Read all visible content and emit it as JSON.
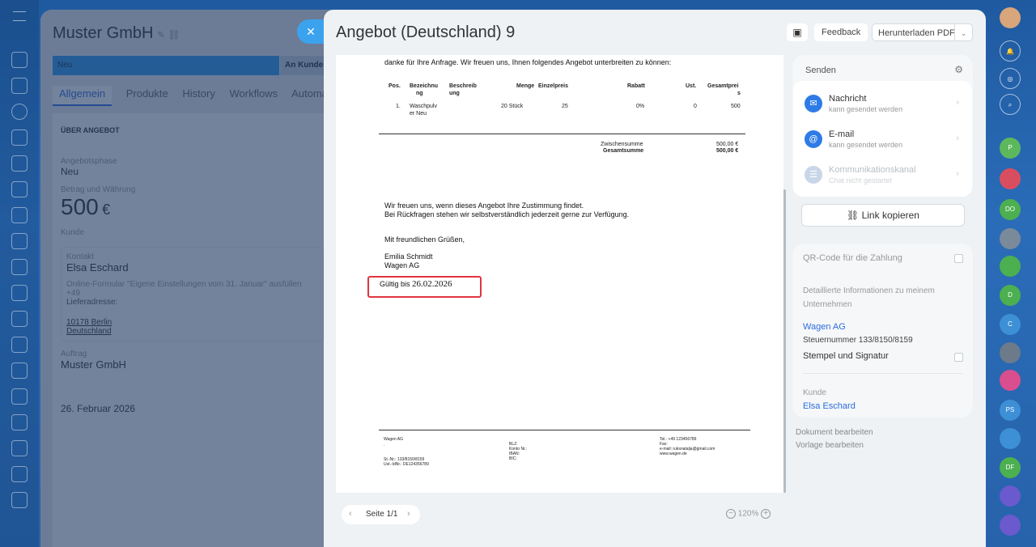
{
  "crm": {
    "title": "Muster GmbH",
    "stage_new": "Neu",
    "stage_next": "An Kunden",
    "tabs": [
      "Allgemein",
      "Produkte",
      "History",
      "Workflows",
      "Automatisie"
    ],
    "section_header": "ÜBER ANGEBOT",
    "phase_label": "Angebotsphase",
    "phase_value": "Neu",
    "amount_label": "Betrag und Währung",
    "amount_value": "500",
    "currency": "€",
    "client_label": "Kunde",
    "contact_label": "Kontakt",
    "contact_name": "Elsa Eschard",
    "form_note": "Online-Formular \"Eigene Einstellungen vom 31. Januar\" ausfüllen",
    "phone_prefix": "+49",
    "delivery_label": "Lieferadresse:",
    "city": "10178 Berlin",
    "country": "Deutschland",
    "company_label": "Auftrag",
    "company_name": "Muster GmbH",
    "date_value": "26. Februar 2026"
  },
  "modal": {
    "title": "Angebot (Deutschland) 9",
    "feedback": "Feedback",
    "download": "Herunterladen PDF"
  },
  "document": {
    "intro": "danke für Ihre Anfrage. Wir freuen uns, Ihnen folgendes Angebot unterbreiten zu können:",
    "columns": [
      "Pos.",
      "Bezeichnung",
      "Beschreibung",
      "Menge",
      "Einzelpreis",
      "Rabatt",
      "Ust.",
      "Gesamtpreis"
    ],
    "col_bez": [
      "Bezeichnu",
      "ng"
    ],
    "col_besch": [
      "Beschreib",
      "ung"
    ],
    "col_ges": [
      "Gesamtprei",
      "s"
    ],
    "row": {
      "pos": "1.",
      "name1": "Waschpulv",
      "name2": "er Neu",
      "menge": "20 Stück",
      "einzelpreis": "25",
      "rabatt": "0%",
      "ust": "0",
      "gesamt": "500"
    },
    "subtotal_label": "Zwischensumme",
    "subtotal_value": "500,00 €",
    "total_label": "Gesamtsumme",
    "total_value": "500,00 €",
    "closing1": "Wir freuen uns, wenn dieses Angebot Ihre Zustimmung findet.",
    "closing2": "Bei Rückfragen stehen wir selbstverständlich jederzeit gerne zur Verfügung.",
    "greeting": "Mit freundlichen Grüßen,",
    "signer": "Emilia Schmidt",
    "company": "Wagen AG",
    "valid_label": "Gültig bis",
    "valid_date": "26.02.2026",
    "footer": {
      "company": "Wagen AG",
      "dot": ".",
      "tax1": "St.-Nr.: 133/8150/8159",
      "tax2": "Ust.-IdNr.: DE124356789",
      "blz": "BLZ:",
      "konto": "Konto Nr.:",
      "iban": "IBAN:",
      "bic": "BIC:",
      "tel": "Tel.: +49 123456789",
      "fax": "Fax:",
      "email": "e-mail: ruksnatalja@gmail.com",
      "web": "www.wagen.de"
    }
  },
  "pager": {
    "label": "Seite 1/1",
    "zoom": "120%"
  },
  "send": {
    "title": "Senden",
    "items": [
      {
        "name": "Nachricht",
        "sub": "kann gesendet werden"
      },
      {
        "name": "E-mail",
        "sub": "kann gesendet werden"
      },
      {
        "name": "Kommunikationskanal",
        "sub": "Chat nicht gestartet"
      }
    ],
    "copy_link": "Link kopieren"
  },
  "info": {
    "qr_label": "QR-Code für die Zahlung",
    "details_label": "Detaillierte Informationen zu meinem Unternehmen",
    "company_link": "Wagen AG",
    "tax_number": "Steuernummer 133/8150/8159",
    "stamp_label": "Stempel und Signatur",
    "client_label": "Kunde",
    "client_link": "Elsa Eschard"
  },
  "edit": {
    "doc": "Dokument bearbeiten",
    "template": "Vorlage bearbeiten"
  },
  "right_bar": [
    "P",
    "DO",
    "D",
    "C",
    "PS",
    "DF"
  ],
  "colors": {
    "accent": "#2d6cdf",
    "highlight": "#e0353f",
    "stage": "#2d9bf0"
  }
}
